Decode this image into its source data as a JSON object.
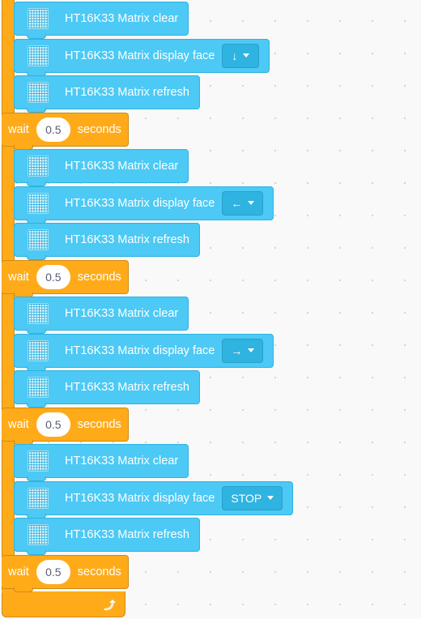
{
  "blocks": [
    {
      "type": "ht",
      "label": "HT16K33 Matrix clear"
    },
    {
      "type": "ht",
      "label": "HT16K33 Matrix display face",
      "dropdown": "↓"
    },
    {
      "type": "ht",
      "label": "HT16K33 Matrix refresh"
    },
    {
      "type": "wait",
      "prefix": "wait",
      "value": "0.5",
      "suffix": "seconds"
    },
    {
      "type": "ht",
      "label": "HT16K33 Matrix clear"
    },
    {
      "type": "ht",
      "label": "HT16K33 Matrix display face",
      "dropdown": "←"
    },
    {
      "type": "ht",
      "label": "HT16K33 Matrix refresh"
    },
    {
      "type": "wait",
      "prefix": "wait",
      "value": "0.5",
      "suffix": "seconds"
    },
    {
      "type": "ht",
      "label": "HT16K33 Matrix clear"
    },
    {
      "type": "ht",
      "label": "HT16K33 Matrix display face",
      "dropdown": "→"
    },
    {
      "type": "ht",
      "label": "HT16K33 Matrix refresh"
    },
    {
      "type": "wait",
      "prefix": "wait",
      "value": "0.5",
      "suffix": "seconds"
    },
    {
      "type": "ht",
      "label": "HT16K33 Matrix clear"
    },
    {
      "type": "ht",
      "label": "HT16K33 Matrix display face",
      "dropdown": "STOP"
    },
    {
      "type": "ht",
      "label": "HT16K33 Matrix refresh"
    },
    {
      "type": "wait",
      "prefix": "wait",
      "value": "0.5",
      "suffix": "seconds"
    }
  ],
  "loop": {
    "icon": "loop-arrow-icon"
  },
  "colors": {
    "workspace": "#f9f9f9",
    "extension_block": "#4cc9f5",
    "control_block": "#ffab19",
    "label": "#ffffff"
  }
}
